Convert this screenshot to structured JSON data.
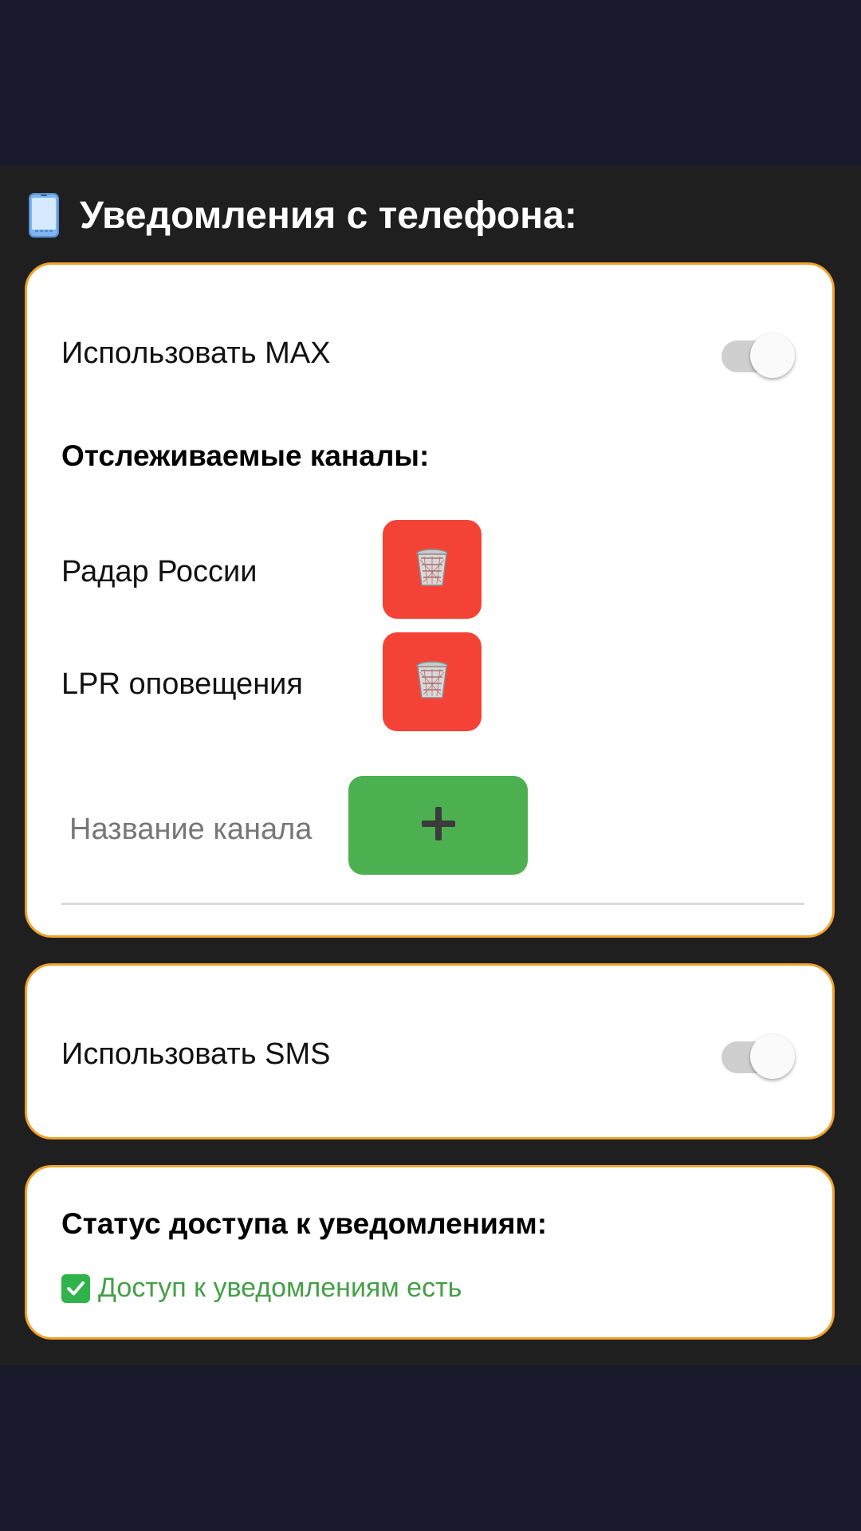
{
  "header": {
    "icon": "phone-icon",
    "title": "Уведомления с телефона:"
  },
  "max_card": {
    "toggle_label": "Использовать MAX",
    "toggle_on": false,
    "channels_heading": "Отслеживаемые каналы:",
    "channels": [
      {
        "name": "Радар России",
        "delete_icon": "trash-icon"
      },
      {
        "name": "LPR оповещения",
        "delete_icon": "trash-icon"
      }
    ],
    "new_channel_placeholder": "Название канала",
    "new_channel_value": "",
    "add_icon": "plus-icon"
  },
  "sms_card": {
    "toggle_label": "Использовать SMS",
    "toggle_on": false
  },
  "status_card": {
    "heading": "Статус доступа  к уведомлениям:",
    "status_icon": "check-mark-icon",
    "status_text": "Доступ к уведомлениям есть"
  },
  "colors": {
    "background": "#181a2c",
    "panel": "#1f1f1f",
    "card_border": "#f0a22a",
    "delete_button": "#f44336",
    "add_button": "#4caf50",
    "status_ok": "#43a047"
  }
}
